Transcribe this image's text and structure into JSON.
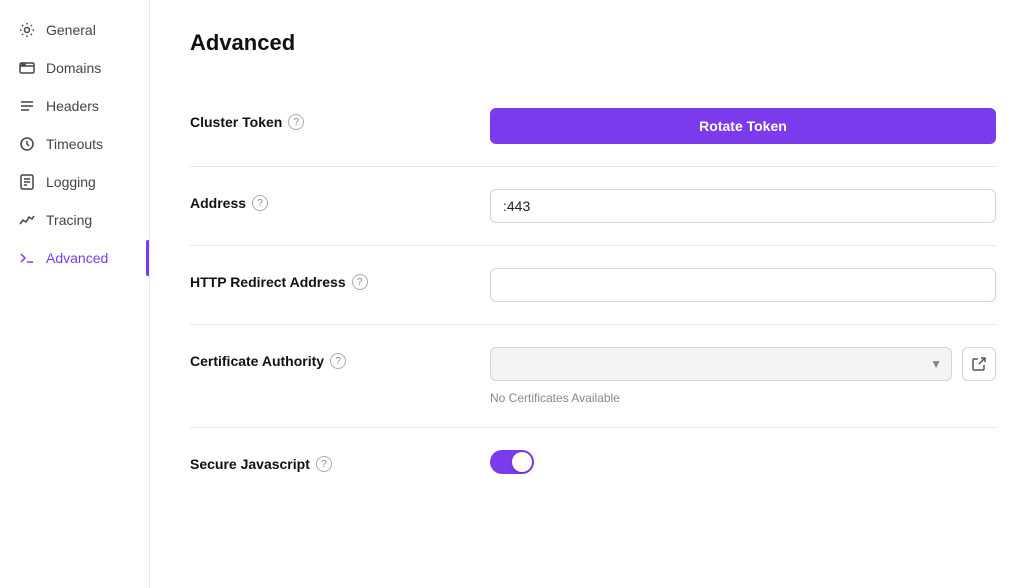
{
  "sidebar": {
    "items": [
      {
        "id": "general",
        "label": "General",
        "icon": "gear",
        "active": false
      },
      {
        "id": "domains",
        "label": "Domains",
        "icon": "domains",
        "active": false
      },
      {
        "id": "headers",
        "label": "Headers",
        "icon": "headers",
        "active": false
      },
      {
        "id": "timeouts",
        "label": "Timeouts",
        "icon": "timeouts",
        "active": false
      },
      {
        "id": "logging",
        "label": "Logging",
        "icon": "logging",
        "active": false
      },
      {
        "id": "tracing",
        "label": "Tracing",
        "icon": "tracing",
        "active": false
      },
      {
        "id": "advanced",
        "label": "Advanced",
        "icon": "advanced",
        "active": true
      }
    ]
  },
  "page": {
    "title": "Advanced"
  },
  "form": {
    "cluster_token": {
      "label": "Cluster Token",
      "button_label": "Rotate Token"
    },
    "address": {
      "label": "Address",
      "value": ":443",
      "placeholder": ""
    },
    "http_redirect": {
      "label": "HTTP Redirect Address",
      "value": "",
      "placeholder": ""
    },
    "certificate_authority": {
      "label": "Certificate Authority",
      "hint": "No Certificates Available",
      "placeholder": ""
    },
    "secure_javascript": {
      "label": "Secure Javascript",
      "enabled": true
    }
  }
}
